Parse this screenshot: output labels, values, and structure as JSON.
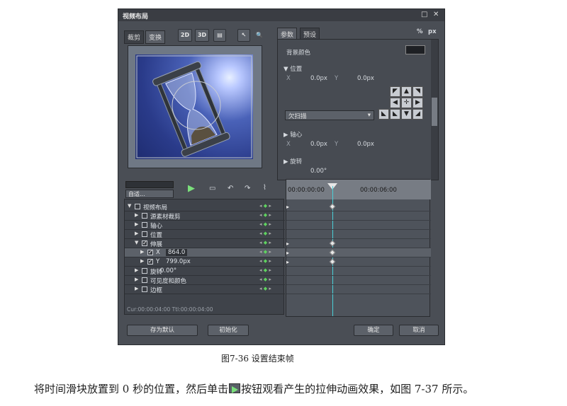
{
  "window": {
    "title": "视频布局",
    "restore_label": "□",
    "close_label": "✕"
  },
  "left_tabs": {
    "crop": "裁剪",
    "transform": "变换"
  },
  "toolbar": {
    "btn_2d": "2D",
    "btn_3d": "3D",
    "btn_extra": "▤",
    "pointer": "↖",
    "zoom": "🔍"
  },
  "right_tabs": {
    "params": "参数",
    "presets": "预设",
    "percent": "%",
    "px": "px"
  },
  "params": {
    "bg_color_label": "背景颜色",
    "position_label": "位置",
    "pos_x_label": "X",
    "pos_x_value": "0.0px",
    "pos_y_label": "Y",
    "pos_y_value": "0.0px",
    "scan_select": "欠扫描",
    "axis_label": "轴心",
    "axis_x_label": "X",
    "axis_x_value": "0.0px",
    "axis_y_label": "Y",
    "axis_y_value": "0.0px",
    "rotate_label": "旋转",
    "rotate_value": "0.00°",
    "bg_color": "#1e2024"
  },
  "timeline_controls": {
    "view_select": "自适...",
    "play": "▶",
    "chat": "▭",
    "undo": "↶",
    "redo": "↷",
    "graph": "⌇"
  },
  "ruler": {
    "t0": "00:00:00:00",
    "t1": "00:00:06:00"
  },
  "tree": [
    {
      "label": "视频布局"
    },
    {
      "label": "源素材裁剪"
    },
    {
      "label": "轴心"
    },
    {
      "label": "位置"
    },
    {
      "label": "伸展"
    },
    {
      "label": "X",
      "value": "864.0"
    },
    {
      "label": "Y",
      "value": "799.0px"
    },
    {
      "label": "旋转",
      "value": "0.00°"
    },
    {
      "label": "可见度和颜色"
    },
    {
      "label": "边框"
    }
  ],
  "status": {
    "cur_total": "Cur:00:00:04:00 Ttl:00:00:04:00"
  },
  "buttons": {
    "save_default": "存为默认",
    "init": "初始化",
    "ok": "确定",
    "cancel": "取消"
  },
  "caption": "图7-36    设置结束帧",
  "body_text": {
    "before": "将时间滑块放置到 0 秒的位置，然后单击",
    "after": "按钮观看产生的拉伸动画效果，如图 7-37 所示。"
  }
}
